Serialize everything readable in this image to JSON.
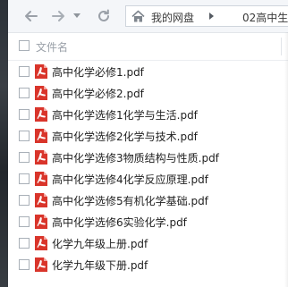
{
  "toolbar": {
    "back_icon": "arrow-left-icon",
    "forward_icon": "arrow-right-icon",
    "dropdown_icon": "chevron-down-icon",
    "refresh_icon": "refresh-icon",
    "home_icon": "home-icon",
    "breadcrumb_root": "我的网盘",
    "breadcrumb_sep_icon": "chevron-right-icon",
    "breadcrumb_current": "02高中生"
  },
  "header": {
    "filename_label": "文件名"
  },
  "files": [
    {
      "name": "高中化学必修1.pdf",
      "icon": "pdf-icon"
    },
    {
      "name": "高中化学必修2.pdf",
      "icon": "pdf-icon"
    },
    {
      "name": "高中化学选修1化学与生活.pdf",
      "icon": "pdf-icon"
    },
    {
      "name": "高中化学选修2化学与技术.pdf",
      "icon": "pdf-icon"
    },
    {
      "name": "高中化学选修3物质结构与性质.pdf",
      "icon": "pdf-icon"
    },
    {
      "name": "高中化学选修4化学反应原理.pdf",
      "icon": "pdf-icon"
    },
    {
      "name": "高中化学选修5有机化学基础.pdf",
      "icon": "pdf-icon"
    },
    {
      "name": "高中化学选修6实验化学.pdf",
      "icon": "pdf-icon"
    },
    {
      "name": "化学九年级上册.pdf",
      "icon": "pdf-icon"
    },
    {
      "name": "化学九年级下册.pdf",
      "icon": "pdf-icon"
    }
  ],
  "colors": {
    "pdf_red": "#d9352b",
    "toolbar_bg": "#f4f6f9",
    "text": "#1f1f1f",
    "muted": "#9aa0a8"
  }
}
